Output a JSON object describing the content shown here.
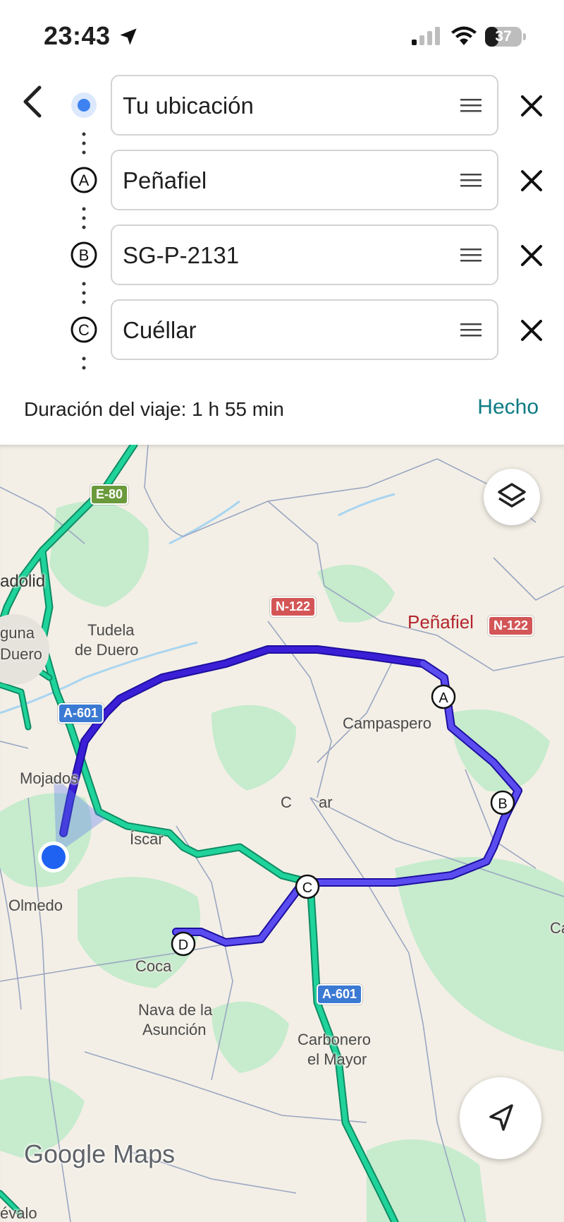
{
  "status_bar": {
    "time": "23:43",
    "battery": "37",
    "battery_level": 0.37
  },
  "stops": [
    {
      "marker": "",
      "value": "Tu ubicación"
    },
    {
      "marker": "A",
      "value": "Peñafiel"
    },
    {
      "marker": "B",
      "value": "SG-P-2131"
    },
    {
      "marker": "C",
      "value": "Cuéllar"
    }
  ],
  "trip": {
    "duration": "Duración del viaje: 1 h 55 min",
    "done_label": "Hecho"
  },
  "map": {
    "places": {
      "valladolid": "adolid",
      "laguna": "guna",
      "duero": "Duero",
      "tudela": "Tudela",
      "tudela2": "de Duero",
      "penafiel": "Peñafiel",
      "campaspero": "Campaspero",
      "mojados": "Mojados",
      "cuellar_l": "C",
      "cuellar_r": "ar",
      "iscar": "Íscar",
      "olmedo": "Olmedo",
      "coca": "Coca",
      "nava1": "Nava de la",
      "nava2": "Asunción",
      "carbonero1": "Carbonero",
      "carbonero2": "el Mayor",
      "arevalo": "évalo",
      "edge_c": "Ca"
    },
    "roads": {
      "e80": "E-80",
      "n122_a": "N-122",
      "n122_b": "N-122",
      "a601_a": "A-601",
      "a601_b": "A-601"
    },
    "waypoints": {
      "a": "A",
      "b": "B",
      "c": "C",
      "d": "D"
    },
    "logo": {
      "google": "Google",
      "maps": "Maps"
    },
    "colors": {
      "route": "#3b1fd6",
      "alt_route": "#1fd39a",
      "water": "#a9d5f0",
      "park": "#c6ebcd"
    }
  }
}
